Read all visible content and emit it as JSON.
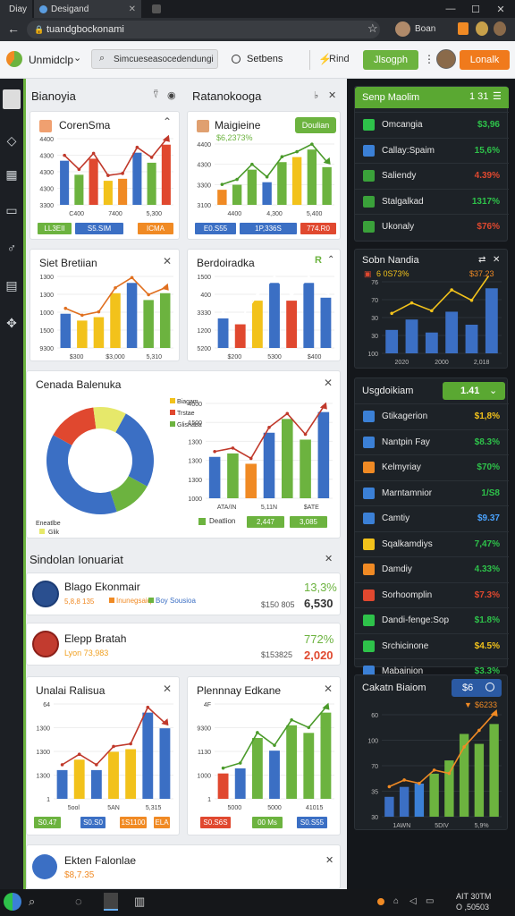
{
  "browser": {
    "tabs": [
      "Diay",
      "Desigand"
    ],
    "url": "tuandgbockonami",
    "profile_label": "Boan"
  },
  "header": {
    "app_name": "Unmidclp",
    "search_placeholder": "Simcueseasocedendungiat",
    "settings_label": "Setbens",
    "rind_label": "Rind",
    "signin_label": "Jlsogph",
    "cta_label": "Lonalk"
  },
  "main": {
    "section1_title": "Bianoyia",
    "section2_title": "Ratanokooga",
    "card1": {
      "title": "CorenSma",
      "ticks": [
        "4400",
        "4300",
        "4300",
        "4300",
        "3300"
      ],
      "xlabels": [
        "C400",
        "7400",
        "5,300"
      ],
      "pills": [
        "LL3EII",
        "S5.SIM",
        "ICMA"
      ],
      "values": [
        2.2,
        1.5,
        2.3,
        1.2,
        1.3,
        2.6,
        2.1,
        3.0
      ]
    },
    "card2": {
      "title": "Maigieine",
      "subtitle": "$6,2373%",
      "button": "Doulian",
      "ticks": [
        "4400",
        "4300",
        "3300",
        "3100"
      ],
      "xlabels": [
        "4400",
        "4,300",
        "5,400"
      ],
      "pills": [
        "E0.S55",
        "1P,336S",
        "774.R0"
      ],
      "values": [
        0.6,
        0.8,
        1.4,
        0.9,
        1.7,
        1.9,
        2.2,
        1.5
      ]
    },
    "card3": {
      "title": "Siet Bretiian",
      "ticks": [
        "1300",
        "1300",
        "1000",
        "1500",
        "9300"
      ],
      "xlabels": [
        "$300",
        "$3,000",
        "5,310"
      ],
      "values": [
        1.0,
        0.8,
        0.9,
        1.6,
        1.9,
        1.4,
        1.6
      ]
    },
    "card4": {
      "title": "Berdoiradka",
      "badge": "R",
      "ticks": [
        "1500",
        "400",
        "3330",
        "1200",
        "5200"
      ],
      "xlabels": [
        "$200",
        "5300",
        "$400"
      ],
      "values": [
        1.0,
        0.8,
        1.6,
        2.2,
        1.6,
        2.2,
        1.7
      ]
    },
    "card5": {
      "title": "Cenada Balenuka",
      "legend": [
        "Biagam",
        "Trstae",
        "Glishaba",
        "Eneatlbe",
        "Glik"
      ],
      "donut": [
        25,
        12,
        38,
        15,
        10
      ],
      "ticks": [
        "4000",
        "1500",
        "1300",
        "1300",
        "1300",
        "1000"
      ],
      "xlabels": [
        "ATA/IN",
        "5,11N",
        "$ATE"
      ],
      "footer_label": "Deatlion",
      "pills": [
        "2,447",
        "3,085"
      ],
      "values": [
        1.2,
        1.3,
        1.0,
        1.9,
        2.3,
        1.7,
        2.5
      ]
    },
    "list_title": "Sindolan Ionuariat",
    "row1": {
      "name": "Blago Ekonmair",
      "sub": "5,8,8 135",
      "tag1": "Inunegsaiq",
      "tag2": "Boy Sousioa",
      "amount": "$150 805",
      "pct": "13,3%",
      "value": "6,530"
    },
    "row2": {
      "name": "Elepp Bratah",
      "sub": "Lyon 73,983",
      "amount": "$153825",
      "pct": "772%",
      "value": "2,020"
    },
    "card6": {
      "title": "Unalai Ralisua",
      "ticks": [
        "64",
        "1300",
        "1300",
        "1300",
        "1"
      ],
      "xlabels": [
        "5ool",
        "5AN",
        "5,315"
      ],
      "pills": [
        "S0.47",
        "S0.S0",
        "1S1100",
        "ELA"
      ],
      "values": [
        1.1,
        1.5,
        1.1,
        1.8,
        1.9,
        3.3,
        2.7
      ]
    },
    "card7": {
      "title": "Plennnay Edkane",
      "ticks": [
        "4F",
        "9300",
        "1130",
        "1000",
        "1"
      ],
      "xlabels": [
        "5000",
        "5000",
        "41015"
      ],
      "pills": [
        "S0.S6S",
        "00 Ms",
        "S0.S55"
      ],
      "values": [
        1.0,
        1.2,
        2.4,
        1.9,
        2.9,
        2.6,
        3.4
      ]
    },
    "card8": {
      "title": "Ekten Falonlae",
      "sub": "$8,7.35"
    }
  },
  "right": {
    "card1": {
      "title": "Senp Maolim",
      "value": "1 31",
      "rows": [
        {
          "label": "Omcangia",
          "value": "$3,96",
          "color": "#2ec24a",
          "icon": "#2ec24a"
        },
        {
          "label": "Callay:Spaim",
          "value": "15,6%",
          "color": "#2ec24a",
          "icon": "#3b80d6"
        },
        {
          "label": "Saliendy",
          "value": "4.39%",
          "color": "#e0482f",
          "icon": "#3aa13a"
        },
        {
          "label": "Stalgalkad",
          "value": "1317%",
          "color": "#2ec24a",
          "icon": "#3aa13a"
        },
        {
          "label": "Ukonaly",
          "value": "$76%",
          "color": "#e0482f",
          "icon": "#3aa13a"
        }
      ]
    },
    "card2": {
      "title": "Sobn Nandia",
      "sub": "6 0S73%",
      "sub2": "$37.23",
      "ticks": [
        "76",
        "70",
        "30",
        "30",
        "100"
      ],
      "xlabels": [
        "2020",
        "2000",
        "2,018"
      ],
      "values": [
        0.9,
        1.3,
        0.8,
        1.6,
        1.1,
        2.5
      ],
      "line": [
        1.4,
        1.8,
        1.5,
        2.3,
        1.9,
        3.0
      ]
    },
    "card3": {
      "title": "Usgdoikiam",
      "value": "1.41",
      "rows": [
        {
          "label": "Gtikagerion",
          "value": "$1,8%",
          "color": "#f2c21b",
          "icon": "#3b80d6"
        },
        {
          "label": "Nantpin Fay",
          "value": "$8.3%",
          "color": "#2ec24a",
          "icon": "#3b80d6"
        },
        {
          "label": "Kelmyriay",
          "value": "$70%",
          "color": "#2ec24a",
          "icon": "#f08a24"
        },
        {
          "label": "Marntamnior",
          "value": "1/S8",
          "color": "#2ec24a",
          "icon": "#3b80d6"
        },
        {
          "label": "Camtiy",
          "value": "$9.37",
          "color": "#4aa3ff",
          "icon": "#3b80d6"
        },
        {
          "label": "Sqalkamdiys",
          "value": "7,47%",
          "color": "#2ec24a",
          "icon": "#f2c21b"
        },
        {
          "label": "Damdiy",
          "value": "4.33%",
          "color": "#2ec24a",
          "icon": "#f08a24"
        },
        {
          "label": "Sorhoomplin",
          "value": "$7.3%",
          "color": "#e0482f",
          "icon": "#e0482f"
        },
        {
          "label": "Dandi-fenge:Sop",
          "value": "$1.8%",
          "color": "#2ec24a",
          "icon": "#2ec24a"
        },
        {
          "label": "Srchicinone",
          "value": "$4.5%",
          "color": "#f2c21b",
          "icon": "#2ec24a"
        },
        {
          "label": "Mabainion",
          "value": "$3.3%",
          "color": "#2ec24a",
          "icon": "#3b80d6"
        }
      ]
    },
    "card4": {
      "title": "Cakatn Biaiom",
      "value": "$6",
      "sub": "$6233",
      "ticks": [
        "60",
        "100",
        "70",
        "35",
        "30"
      ],
      "xlabels": [
        "1AWN",
        "5DIV",
        "5,9%"
      ],
      "values": [
        0.6,
        0.9,
        1.0,
        1.3,
        1.7,
        2.5,
        2.2,
        2.8
      ],
      "line": [
        0.8,
        1.0,
        0.9,
        1.3,
        1.2,
        2.0,
        2.5,
        3.0
      ]
    }
  },
  "taskbar": {
    "time": "AIT 30TM",
    "date": "O ,50503"
  },
  "colors": {
    "green": "#6cb33f",
    "orange": "#f08a24",
    "blue": "#3b6fc4",
    "red": "#e0482f",
    "yellow": "#f2c21b"
  }
}
